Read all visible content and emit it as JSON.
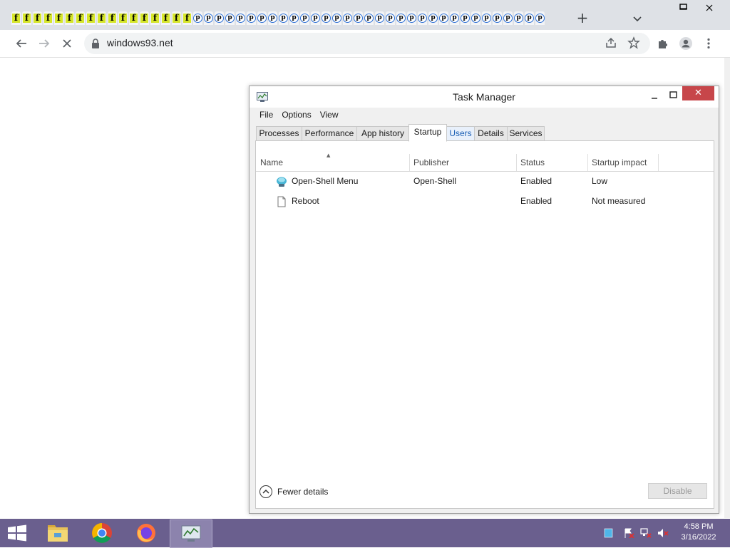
{
  "browser": {
    "tab_count_left": 17,
    "tab_count_right": 33,
    "tab_favicon_left": "f",
    "tab_favicon_right": "p",
    "url": "windows93.net",
    "new_tab_symbol": "+"
  },
  "task_manager": {
    "title": "Task Manager",
    "close_symbol": "✕",
    "menu": [
      "File",
      "Options",
      "View"
    ],
    "tabs": [
      "Processes",
      "Performance",
      "App history",
      "Startup",
      "Users",
      "Details",
      "Services"
    ],
    "active_tab": "Startup",
    "columns": [
      "Name",
      "Publisher",
      "Status",
      "Startup impact"
    ],
    "rows": [
      {
        "name": "Open-Shell Menu",
        "publisher": "Open-Shell",
        "status": "Enabled",
        "impact": "Low",
        "icon": "open-shell-icon"
      },
      {
        "name": "Reboot",
        "publisher": "",
        "status": "Enabled",
        "impact": "Not measured",
        "icon": "document-icon"
      }
    ],
    "fewer_details": "Fewer details",
    "disable_button": "Disable"
  },
  "taskbar": {
    "apps": [
      "file-explorer-icon",
      "chrome-icon",
      "firefox-icon",
      "task-manager-icon"
    ],
    "clock_time": "4:58 PM",
    "clock_date": "3/16/2022"
  },
  "colors": {
    "taskbar": "#6a5f8e",
    "close_red": "#c7464a",
    "tabstrip": "#dee1e6"
  }
}
